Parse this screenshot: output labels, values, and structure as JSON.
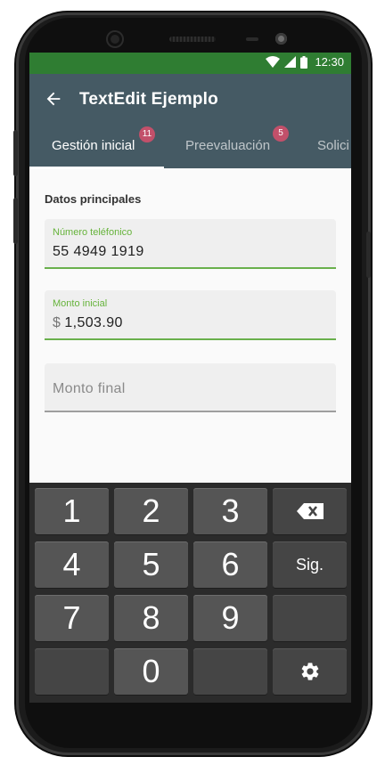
{
  "statusbar": {
    "time": "12:30"
  },
  "appbar": {
    "title": "TextEdit Ejemplo"
  },
  "tabs": [
    {
      "label": "Gestión inicial",
      "badge": "11"
    },
    {
      "label": "Preevaluación",
      "badge": "5"
    },
    {
      "label": "Solici"
    }
  ],
  "form": {
    "section_title": "Datos principales",
    "phone": {
      "label": "Número teléfonico",
      "value": "55 4949 1919"
    },
    "initial_amount": {
      "label": "Monto inicial",
      "prefix": "$",
      "value": "1,503.90"
    },
    "final_amount": {
      "placeholder": "Monto final"
    }
  },
  "keyboard": {
    "digits": [
      "1",
      "2",
      "3",
      "4",
      "5",
      "6",
      "7",
      "8",
      "9",
      "0"
    ],
    "next_label": "Sig.",
    "icons": [
      "backspace-icon",
      "settings-icon"
    ]
  },
  "colors": {
    "statusbar": "#2f7d32",
    "appbar": "#455a64",
    "accent_green": "#66b33b",
    "badge": "#c2506a",
    "keyboard_bg": "#2b2b2b"
  }
}
